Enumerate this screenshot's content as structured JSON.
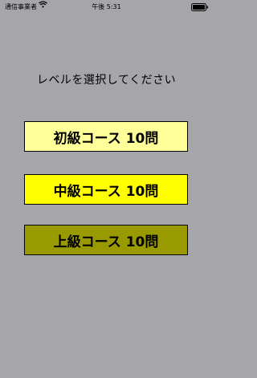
{
  "status_bar": {
    "carrier": "通信事業者",
    "time": "午後 5:31"
  },
  "screen": {
    "title": "レベルを選択してください"
  },
  "courses": [
    {
      "label": "初級コース 10問",
      "color": "#ffff99"
    },
    {
      "label": "中級コース 10問",
      "color": "#ffff00"
    },
    {
      "label": "上級コース 10問",
      "color": "#999900"
    }
  ],
  "icons": [
    "wifi-icon",
    "battery-icon"
  ]
}
